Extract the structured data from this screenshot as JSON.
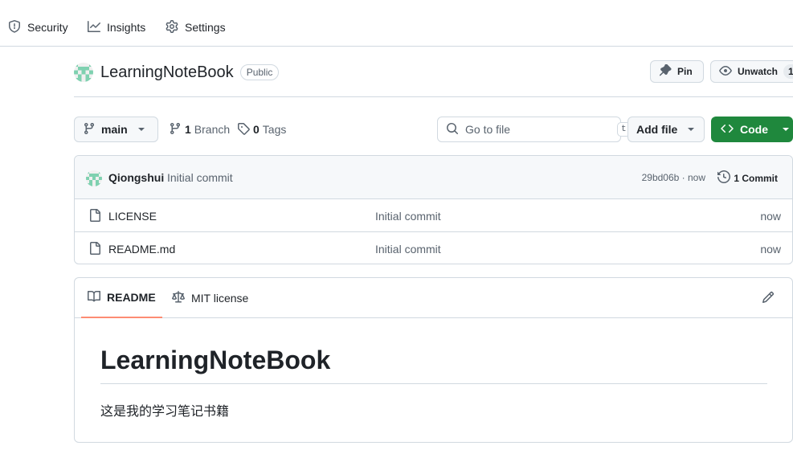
{
  "nav": {
    "items": [
      {
        "label": "Security",
        "icon": "shield-icon"
      },
      {
        "label": "Insights",
        "icon": "graph-icon"
      },
      {
        "label": "Settings",
        "icon": "gear-icon"
      }
    ]
  },
  "repo": {
    "name": "LearningNoteBook",
    "visibility": "Public",
    "pin_label": "Pin",
    "unwatch_label": "Unwatch",
    "watch_count": "1"
  },
  "toolbar": {
    "branch": "main",
    "branch_count": "1",
    "branch_label": "Branch",
    "tag_count": "0",
    "tag_label": "Tags",
    "search_placeholder": "Go to file",
    "search_shortcut": "t",
    "add_file_label": "Add file",
    "code_label": "Code"
  },
  "commit": {
    "author": "Qiongshui",
    "message": "Initial commit",
    "hash_time": "29bd06b · now",
    "count_label": "1 Commit"
  },
  "files": [
    {
      "name": "LICENSE",
      "commit": "Initial commit",
      "time": "now"
    },
    {
      "name": "README.md",
      "commit": "Initial commit",
      "time": "now"
    }
  ],
  "readme": {
    "tabs": [
      "README",
      "MIT license"
    ],
    "heading": "LearningNoteBook",
    "body": "这是我的学习笔记书籍"
  },
  "colors": {
    "primary_green": "#1f883d",
    "tab_underline": "#fd8c73",
    "border": "#d1d9e0"
  }
}
